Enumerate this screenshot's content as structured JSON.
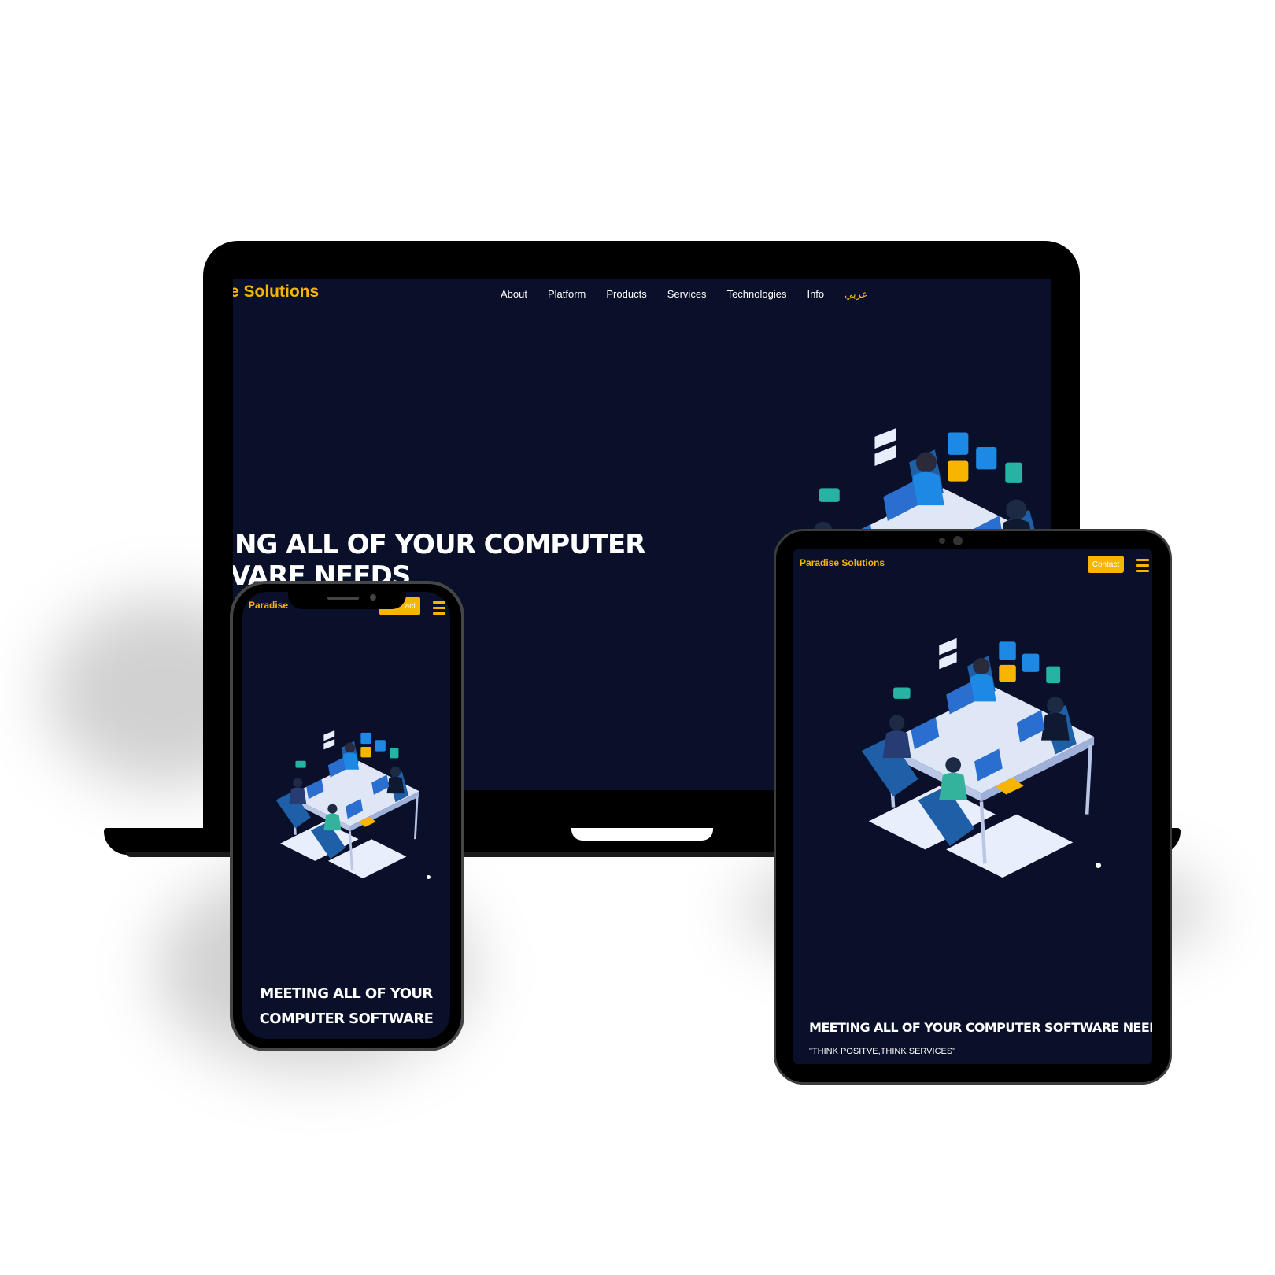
{
  "colors": {
    "screen_bg": "#0a1029",
    "brand": "#f7b500",
    "text": "#ffffff",
    "device_frame": "#000000"
  },
  "laptop": {
    "brand": "e Solutions",
    "nav": [
      "About",
      "Platform",
      "Products",
      "Services",
      "Technologies",
      "Info"
    ],
    "lang": "عربي",
    "hero_line1": "NG ALL OF YOUR COMPUTER",
    "hero_line2": "VARE NEEDS"
  },
  "tablet": {
    "brand": "Paradise Solutions",
    "contact": "Contact",
    "menu_icon": "hamburger-icon",
    "hero_title": "MEETING ALL OF YOUR COMPUTER SOFTWARE NEEDS",
    "hero_subtitle": "\"THINK POSITVE,THINK SERVICES\""
  },
  "phone": {
    "brand": "Paradise",
    "contact": "act",
    "menu_icon": "hamburger-icon",
    "hero_line1": "MEETING ALL OF YOUR",
    "hero_line2": "COMPUTER SOFTWARE"
  },
  "illustration": {
    "name": "isometric-team-at-desk-illustration",
    "icons": [
      "gear-icon",
      "search-icon",
      "code-icon",
      "braces-icon",
      "chat-bubble-icon",
      "check-icon"
    ]
  }
}
